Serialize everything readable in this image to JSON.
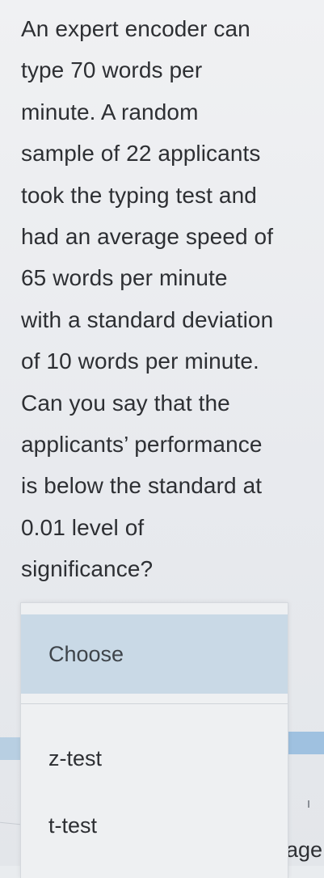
{
  "question": {
    "lines": [
      "An expert encoder can",
      "type 70 words per",
      "minute. A random",
      "sample of 22 applicants",
      "took the typing test and",
      "had an average speed of",
      "65 words per minute",
      "with a standard deviation",
      "of 10 words per minute.",
      "Can you say that the",
      "applicants’ performance",
      "is below the standard at",
      "0.01 level of",
      "significance?"
    ]
  },
  "dropdown": {
    "selected_placeholder": "Choose",
    "options": [
      "z-test",
      "t-test"
    ]
  },
  "background": {
    "partial_text": "age"
  },
  "colors": {
    "highlight": "#c9d9e6",
    "text": "#2d2f33",
    "page_background": "#e9ecef"
  }
}
